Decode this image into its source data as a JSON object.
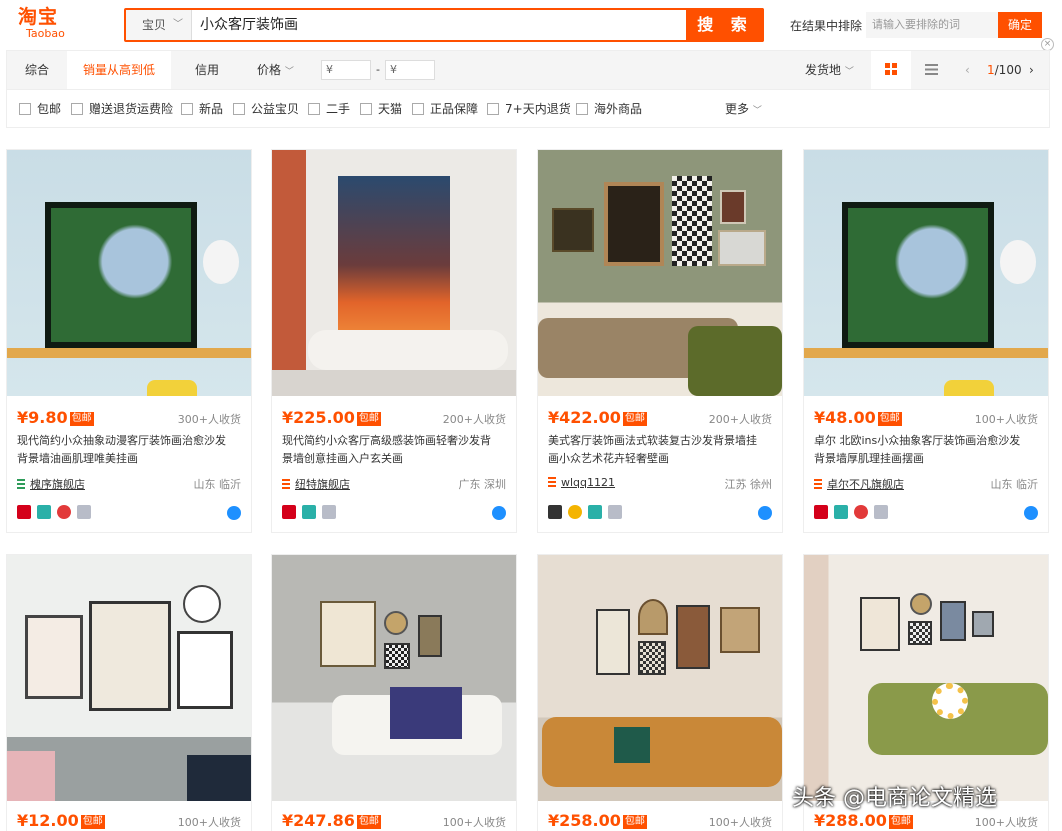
{
  "header": {
    "logo_cn": "淘宝",
    "logo_en": "Taobao",
    "search_category": "宝贝",
    "search_query": "小众客厅装饰画",
    "search_button": "搜 索",
    "exclude_label": "在结果中排除",
    "exclude_placeholder": "请输入要排除的词",
    "exclude_button": "确定"
  },
  "sortbar": {
    "items": [
      "综合",
      "销量从高到低",
      "信用",
      "价格"
    ],
    "price_from": "¥",
    "price_dash": "-",
    "price_to": "¥",
    "ship_from": "发货地",
    "page_current": "1",
    "page_total": "/100"
  },
  "filters": [
    "包邮",
    "赠送退货运费险",
    "新品",
    "公益宝贝",
    "二手",
    "天猫",
    "正品保障",
    "7+天内退货",
    "海外商品"
  ],
  "more_label": "更多",
  "badge_label": "包邮",
  "products": [
    {
      "price": "¥9.80",
      "sold": "300+人收货",
      "title_1": "现代简约小众抽象动漫客厅装饰画治愈沙发",
      "title_2": "背景墙油画肌理唯美挂画",
      "shop": "槐序旗舰店",
      "location": "山东 临沂"
    },
    {
      "price": "¥225.00",
      "sold": "200+人收货",
      "title_1": "现代简约小众客厅高级感装饰画轻奢沙发背",
      "title_2": "景墙创意挂画入户玄关画",
      "shop": "纽特旗舰店",
      "location": "广东 深圳"
    },
    {
      "price": "¥422.00",
      "sold": "200+人收货",
      "title_1": "美式客厅装饰画法式软装复古沙发背景墙挂",
      "title_2": "画小众艺术花卉轻奢壁画",
      "shop": "wlqq1121",
      "location": "江苏 徐州"
    },
    {
      "price": "¥48.00",
      "sold": "100+人收货",
      "title_1": "卓尔 北欧ins小众抽象客厅装饰画治愈沙发",
      "title_2": "背景墙厚肌理挂画摆画",
      "shop": "卓尔不凡旗舰店",
      "location": "山东 临沂"
    },
    {
      "price": "¥12.00",
      "sold": "100+人收货"
    },
    {
      "price": "¥247.86",
      "sold": "100+人收货"
    },
    {
      "price": "¥258.00",
      "sold": "100+人收货"
    },
    {
      "price": "¥288.00",
      "sold": "100+人收货"
    }
  ],
  "watermark": "头条 @电商论文精选",
  "colors": {
    "accent": "#ff5000",
    "ww_blue": "#1e90ff"
  }
}
